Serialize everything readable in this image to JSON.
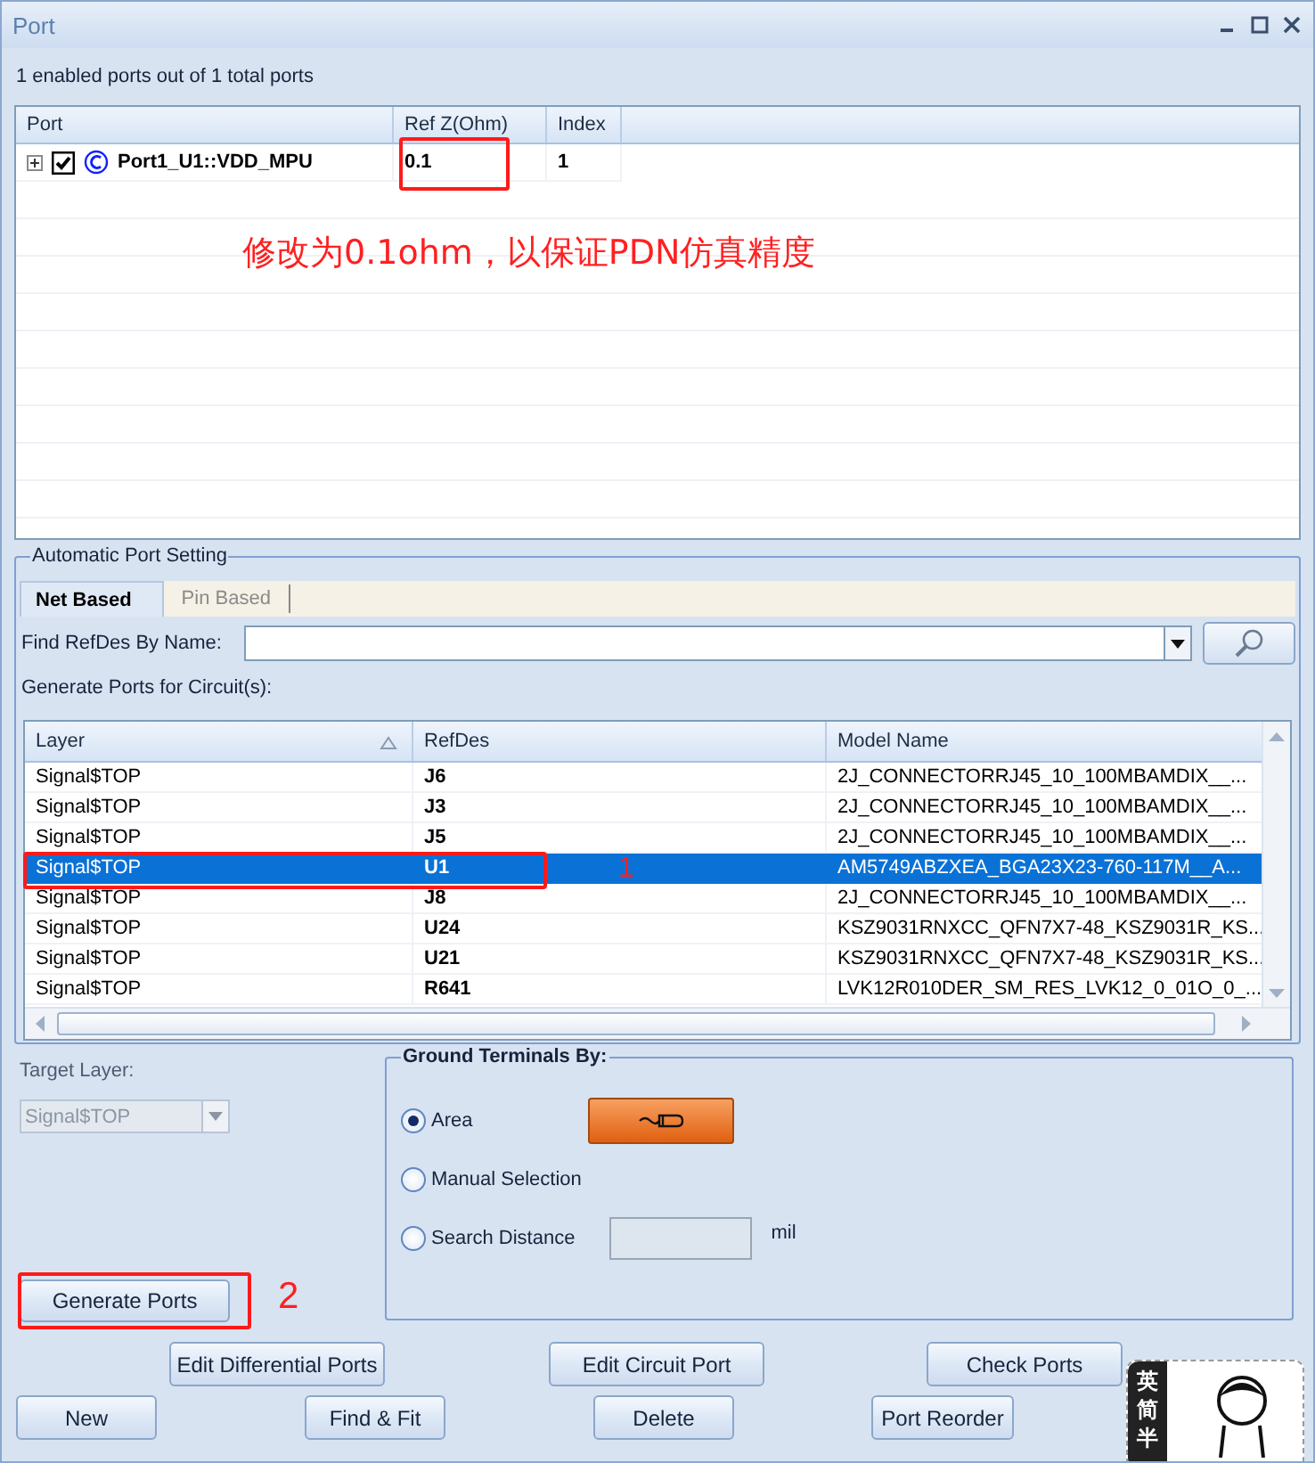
{
  "window": {
    "title": "Port"
  },
  "status": "1 enabled ports out of 1 total ports",
  "ports_table": {
    "columns": [
      "Port",
      "Ref Z(Ohm)",
      "Index"
    ],
    "rows": [
      {
        "expanded": false,
        "checked": true,
        "port": "Port1_U1::VDD_MPU",
        "ref_z": "0.1",
        "index": "1"
      }
    ]
  },
  "automatic_port_setting": {
    "title": "Automatic Port Setting",
    "tabs": [
      {
        "label": "Net Based",
        "selected": true
      },
      {
        "label": "Pin Based",
        "selected": false
      }
    ],
    "find_label": "Find RefDes By Name:",
    "generate_label": "Generate Ports for Circuit(s):",
    "circuits_table": {
      "columns": [
        "Layer",
        "RefDes",
        "Model Name"
      ],
      "rows": [
        {
          "layer": "Signal$TOP",
          "refdes": "J6",
          "model": "2J_CONNECTORRJ45_10_100MBAMDIX__...",
          "selected": false
        },
        {
          "layer": "Signal$TOP",
          "refdes": "J3",
          "model": "2J_CONNECTORRJ45_10_100MBAMDIX__...",
          "selected": false
        },
        {
          "layer": "Signal$TOP",
          "refdes": "J5",
          "model": "2J_CONNECTORRJ45_10_100MBAMDIX__...",
          "selected": false
        },
        {
          "layer": "Signal$TOP",
          "refdes": "U1",
          "model": "AM5749ABZXEA_BGA23X23-760-117M__A...",
          "selected": true
        },
        {
          "layer": "Signal$TOP",
          "refdes": "J8",
          "model": "2J_CONNECTORRJ45_10_100MBAMDIX__...",
          "selected": false
        },
        {
          "layer": "Signal$TOP",
          "refdes": "U24",
          "model": "KSZ9031RNXCC_QFN7X7-48_KSZ9031R_KS...",
          "selected": false
        },
        {
          "layer": "Signal$TOP",
          "refdes": "U21",
          "model": "KSZ9031RNXCC_QFN7X7-48_KSZ9031R_KS...",
          "selected": false
        },
        {
          "layer": "Signal$TOP",
          "refdes": "R641",
          "model": "LVK12R010DER_SM_RES_LVK12_0_01O_0_...",
          "selected": false
        }
      ]
    }
  },
  "target_layer": {
    "label": "Target Layer:",
    "value": "Signal$TOP",
    "disabled": true
  },
  "ground_terminals": {
    "title": "Ground Terminals By:",
    "options": [
      {
        "label": "Area",
        "selected": true
      },
      {
        "label": "Manual Selection",
        "selected": false
      },
      {
        "label": "Search Distance",
        "selected": false
      }
    ],
    "distance_unit": "mil"
  },
  "generate_button": "Generate Ports",
  "buttons_row1": [
    "Edit Differential Ports",
    "Edit Circuit Port",
    "Check Ports"
  ],
  "buttons_row2": [
    "New",
    "Find & Fit",
    "Delete",
    "Port Reorder"
  ],
  "annotations": [
    {
      "kind": "note",
      "text": "修改为0.1ohm，以保证PDN仿真精度"
    },
    {
      "kind": "step",
      "text": "1"
    },
    {
      "kind": "step",
      "text": "2"
    }
  ],
  "ime_toolbar": {
    "keys": [
      "英",
      "简",
      "半"
    ]
  }
}
